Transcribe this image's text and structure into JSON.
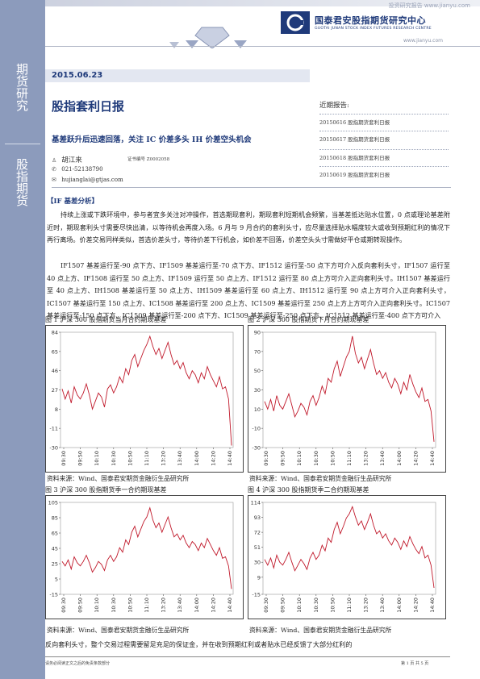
{
  "header": {
    "watermark": "投资研究报告 www.jianyu.com",
    "org_cn": "国泰君安股指期货研究中心",
    "org_en": "GUOTAI JUNAN STOCK INDEX FUTURES RESEARCH CENTRE",
    "url": "www.jianyu.com"
  },
  "sidebar": {
    "label_top": "期货研究",
    "label_bottom": "股指期货"
  },
  "report": {
    "date": "2015.06.23",
    "title": "股指套利日报",
    "subtitle": "基差跃升后迅速回落，关注 IC 价差多头 IH 价差空头机会"
  },
  "recent": {
    "title": "近期报告:",
    "items": [
      "20150616 股指期货套利日报",
      "20150617 股指期货套利日报",
      "20150618 股指期货套利日报",
      "20150619 股指期货套利日报"
    ]
  },
  "analyst": {
    "name": "胡江来",
    "cert_label": "证书编号 Z0002058",
    "phone": "021-52138790",
    "email": "hujianglai@gtjas.com"
  },
  "body": {
    "section": "【IF 基差分析】",
    "p1": "持续上涨或下跌环境中，参与者宜多关注对冲操作，首选期现套利，期现套利短期机会频繁，当基差抵达贴水位置，0 点或理论基差附近时，期现套利头寸需要尽快出清，以等待机会再度入场。6 月与 9 月合约的套利头寸，应尽量选择贴水幅度较大或收到预期红利的情况下再行离场。价差交易同样类似，首选价差头寸，等待价差下行机会，如价差不回落，价差空头头寸需做好平仓或期转现操作。",
    "p2": "IF1507 基差运行至-90 点下方、IF1509 基差运行至-70 点下方、IF1512 运行至-50 点下方可介入反向套利头寸，IF1507 运行至 40 点上方、IF1508 运行至 50 点上方、IF1509 运行至 50 点上方、IF1512 运行至 80 点上方可介入正向套利头寸。IH1507 基差运行至 40 点上方、IH1508 基差运行至 50 点上方、IH1509 基差运行至 60 点上方、IH1512 运行至 90 点上方可介入正向套利头寸，IC1507 基差运行至 150 点上方、IC1508 基差运行至 200 点上方、IC1509 基差运行至 250 点上方上方可介入正向套利头寸。IC1507 基差运行至-150 点下方、IC1509 基差运行至-200 点下方、IC1509 基差运行至-250 点下方、IC1512 基差运行至-400 点下方可介入",
    "last_line": "反向套利头寸，整个交易过程需要留足充足的保证金，并在收到预期红利或者贴水已经反馈了大部分红利的"
  },
  "figures": {
    "source": "资料来源：Wind、国泰君安期货金融衍生品研究所",
    "x_ticks": [
      "09:30",
      "09:50",
      "10:10",
      "10:30",
      "10:50",
      "11:10",
      "13:20",
      "13:40",
      "14:00",
      "14:20",
      "14:40"
    ],
    "fig1_title": "图 1 沪深 300 股指期货当月合约期现基差",
    "fig2_title": "图 2 沪深 300 股指期货下月合约期现基差",
    "fig3_title": "图 3 沪深 300 股指期货季一合约期现基差",
    "fig4_title": "图 4 沪深 300 股指期货季二合约期现基差"
  },
  "chart_data": [
    {
      "type": "line",
      "title": "图 1 沪深 300 股指期货当月合约期现基差",
      "ylim": [
        -30,
        84
      ],
      "yticks": [
        84,
        65,
        46,
        27,
        8,
        -11,
        -30
      ],
      "values": [
        28,
        18,
        26,
        14,
        30,
        22,
        18,
        24,
        33,
        22,
        8,
        16,
        24,
        20,
        10,
        28,
        32,
        24,
        30,
        40,
        34,
        48,
        42,
        56,
        62,
        50,
        58,
        66,
        72,
        80,
        70,
        62,
        68,
        58,
        66,
        74,
        62,
        52,
        56,
        48,
        54,
        44,
        38,
        46,
        42,
        34,
        44,
        38,
        50,
        42,
        36,
        30,
        40,
        28,
        30,
        18,
        -28
      ]
    },
    {
      "type": "line",
      "title": "图 2 沪深 300 股指期货下月合约期现基差",
      "ylim": [
        -30,
        90
      ],
      "yticks": [
        90,
        70,
        50,
        30,
        10,
        -10,
        -30
      ],
      "values": [
        18,
        10,
        20,
        8,
        24,
        14,
        10,
        18,
        26,
        14,
        2,
        8,
        16,
        12,
        4,
        18,
        24,
        14,
        22,
        34,
        26,
        42,
        38,
        52,
        60,
        44,
        54,
        64,
        70,
        86,
        68,
        58,
        64,
        52,
        62,
        72,
        58,
        46,
        50,
        42,
        48,
        38,
        32,
        42,
        36,
        26,
        38,
        30,
        46,
        36,
        28,
        22,
        32,
        18,
        20,
        8,
        -24
      ]
    },
    {
      "type": "line",
      "title": "图 3 沪深 300 股指期货季一合约期现基差",
      "ylim": [
        -15,
        105
      ],
      "yticks": [
        105,
        85,
        65,
        45,
        25,
        5,
        -15
      ],
      "values": [
        28,
        22,
        30,
        18,
        34,
        26,
        22,
        28,
        36,
        26,
        14,
        20,
        28,
        24,
        16,
        30,
        36,
        28,
        34,
        46,
        40,
        56,
        50,
        66,
        74,
        60,
        70,
        80,
        86,
        98,
        82,
        72,
        78,
        66,
        76,
        86,
        72,
        60,
        64,
        56,
        62,
        52,
        46,
        54,
        50,
        42,
        52,
        46,
        58,
        50,
        42,
        36,
        46,
        32,
        34,
        22,
        -8
      ]
    },
    {
      "type": "line",
      "title": "图 4 沪深 300 股指期货季二合约期现基差",
      "ylim": [
        -15,
        114
      ],
      "yticks": [
        114,
        93,
        72,
        51,
        30,
        9,
        -15
      ],
      "values": [
        34,
        26,
        36,
        22,
        40,
        30,
        26,
        34,
        44,
        30,
        18,
        26,
        34,
        28,
        20,
        36,
        44,
        34,
        40,
        54,
        46,
        64,
        58,
        76,
        86,
        70,
        80,
        92,
        98,
        108,
        94,
        82,
        88,
        76,
        86,
        98,
        82,
        70,
        74,
        64,
        70,
        60,
        54,
        64,
        58,
        48,
        60,
        52,
        66,
        56,
        48,
        42,
        52,
        36,
        40,
        26,
        -6
      ]
    }
  ]
}
